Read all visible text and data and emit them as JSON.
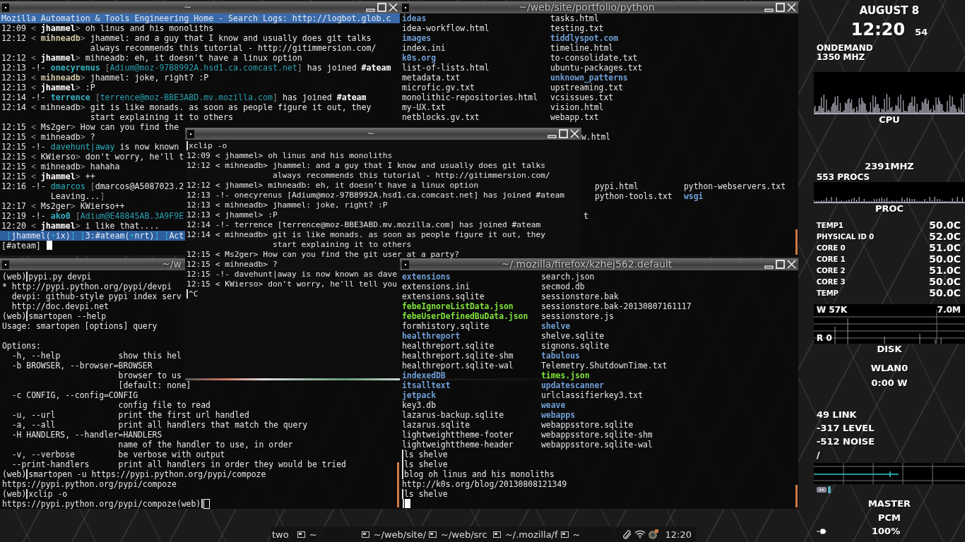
{
  "irc_window": {
    "title": "~",
    "window_buttons": true,
    "topic": "Mozilla Automation & Tools Engineering Home - Search Logs: http://logbot.glob.c",
    "lines": [
      {
        "segments": [
          {
            "kind": "time",
            "text": "12:09"
          },
          {
            "kind": "dim",
            "text": " < "
          },
          {
            "kind": "bold",
            "text": "jhammel"
          },
          {
            "kind": "dim",
            "text": "> "
          },
          {
            "kind": "text",
            "text": "oh linus and his monoliths"
          }
        ]
      },
      {
        "segments": [
          {
            "kind": "time",
            "text": "12:12"
          },
          {
            "kind": "dim",
            "text": " < "
          },
          {
            "kind": "tan",
            "text": "mihneadb"
          },
          {
            "kind": "dim",
            "text": "> "
          },
          {
            "kind": "text",
            "text": "jhammel: and a guy that I know and usually does git talks"
          }
        ]
      },
      {
        "text": "                  always recommends this tutorial - http://gitimmersion.com/"
      },
      {
        "segments": [
          {
            "kind": "time",
            "text": "12:12"
          },
          {
            "kind": "dim",
            "text": " < "
          },
          {
            "kind": "bold",
            "text": "jhammel"
          },
          {
            "kind": "dim",
            "text": "> "
          },
          {
            "kind": "text",
            "text": "mihneadb: eh, it doesn't have a linux option"
          }
        ]
      },
      {
        "segments": [
          {
            "kind": "time",
            "text": "12:13"
          },
          {
            "kind": "text",
            "text": " -!- "
          },
          {
            "kind": "join",
            "text": "onecyrenus"
          },
          {
            "kind": "dim",
            "text": " ["
          },
          {
            "kind": "host",
            "text": "Adium@moz-97B8992A.hsd1.ca.comcast.net"
          },
          {
            "kind": "dim",
            "text": "]"
          },
          {
            "kind": "text",
            "text": " has joined "
          },
          {
            "kind": "bold",
            "text": "#ateam"
          }
        ]
      },
      {
        "segments": [
          {
            "kind": "time",
            "text": "12:13"
          },
          {
            "kind": "dim",
            "text": " < "
          },
          {
            "kind": "tan",
            "text": "mihneadb"
          },
          {
            "kind": "dim",
            "text": "> "
          },
          {
            "kind": "text",
            "text": "jhammel: joke, right? :P"
          }
        ]
      },
      {
        "segments": [
          {
            "kind": "time",
            "text": "12:13"
          },
          {
            "kind": "dim",
            "text": " < "
          },
          {
            "kind": "bold",
            "text": "jhammel"
          },
          {
            "kind": "dim",
            "text": "> "
          },
          {
            "kind": "text",
            "text": ":P"
          }
        ]
      },
      {
        "segments": [
          {
            "kind": "time",
            "text": "12:14"
          },
          {
            "kind": "text",
            "text": " -!- "
          },
          {
            "kind": "join",
            "text": "terrence"
          },
          {
            "kind": "dim",
            "text": " ["
          },
          {
            "kind": "host",
            "text": "terrence@moz-BBE3ABD.mv.mozilla.com"
          },
          {
            "kind": "dim",
            "text": "]"
          },
          {
            "kind": "text",
            "text": " has joined "
          },
          {
            "kind": "bold",
            "text": "#ateam"
          }
        ]
      },
      {
        "segments": [
          {
            "kind": "time",
            "text": "12:14"
          },
          {
            "kind": "dim",
            "text": " < "
          },
          {
            "kind": "text",
            "text": "mihneadb"
          },
          {
            "kind": "dim",
            "text": "> "
          },
          {
            "kind": "text",
            "text": "git is like monads. as soon as people figure it out, they"
          }
        ]
      },
      {
        "text": "                  start explaining it to others"
      },
      {
        "segments": [
          {
            "kind": "time",
            "text": "12:15"
          },
          {
            "kind": "dim",
            "text": " < "
          },
          {
            "kind": "text",
            "text": "Ms2ger"
          },
          {
            "kind": "dim",
            "text": "> "
          },
          {
            "kind": "text",
            "text": "How can you find the"
          }
        ]
      },
      {
        "segments": [
          {
            "kind": "time",
            "text": "12:15"
          },
          {
            "kind": "dim",
            "text": " < "
          },
          {
            "kind": "text",
            "text": "mihneadb"
          },
          {
            "kind": "dim",
            "text": "> "
          },
          {
            "kind": "text",
            "text": "?"
          }
        ]
      },
      {
        "segments": [
          {
            "kind": "time",
            "text": "12:15"
          },
          {
            "kind": "text",
            "text": " -!- "
          },
          {
            "kind": "teal",
            "text": "davehunt|away"
          },
          {
            "kind": "text",
            "text": " is now known"
          }
        ]
      },
      {
        "segments": [
          {
            "kind": "time",
            "text": "12:15"
          },
          {
            "kind": "dim",
            "text": " < "
          },
          {
            "kind": "text",
            "text": "KWierso"
          },
          {
            "kind": "dim",
            "text": "> "
          },
          {
            "kind": "text",
            "text": "don't worry, he'll t"
          }
        ]
      },
      {
        "segments": [
          {
            "kind": "time",
            "text": "12:15"
          },
          {
            "kind": "dim",
            "text": " < "
          },
          {
            "kind": "text",
            "text": "mihneadb"
          },
          {
            "kind": "dim",
            "text": "> "
          },
          {
            "kind": "text",
            "text": "hahaha"
          }
        ]
      },
      {
        "segments": [
          {
            "kind": "time",
            "text": "12:15"
          },
          {
            "kind": "dim",
            "text": " < "
          },
          {
            "kind": "bold",
            "text": "jhammel"
          },
          {
            "kind": "dim",
            "text": "> "
          },
          {
            "kind": "text",
            "text": "++"
          }
        ]
      },
      {
        "segments": [
          {
            "kind": "time",
            "text": "12:16"
          },
          {
            "kind": "text",
            "text": " -!- "
          },
          {
            "kind": "teal",
            "text": "dmarcos"
          },
          {
            "kind": "dim",
            "text": " ["
          },
          {
            "kind": "text",
            "text": "dmarcos@A5087023.2"
          }
        ]
      },
      {
        "segments": [
          {
            "kind": "text",
            "text": "          Leaving..."
          },
          {
            "kind": "dim",
            "text": "]"
          }
        ]
      },
      {
        "segments": [
          {
            "kind": "time",
            "text": "12:17"
          },
          {
            "kind": "dim",
            "text": " < "
          },
          {
            "kind": "text",
            "text": "Ms2ger"
          },
          {
            "kind": "dim",
            "text": "> "
          },
          {
            "kind": "text",
            "text": "KWierso++"
          }
        ]
      },
      {
        "segments": [
          {
            "kind": "time",
            "text": "12:19"
          },
          {
            "kind": "text",
            "text": " -!- "
          },
          {
            "kind": "join",
            "text": "ako0"
          },
          {
            "kind": "dim",
            "text": " ["
          },
          {
            "kind": "host",
            "text": "Adium@E48845AB.3A9F9E"
          }
        ]
      },
      {
        "segments": [
          {
            "kind": "time",
            "text": "12:20"
          },
          {
            "kind": "dim",
            "text": " < "
          },
          {
            "kind": "bold",
            "text": "jhammel"
          },
          {
            "kind": "dim",
            "text": "> "
          },
          {
            "kind": "text",
            "text": "i like that...."
          }
        ]
      }
    ],
    "status": [
      {
        "kind": "bracket",
        "text": " ["
      },
      {
        "kind": "text",
        "text": "jhammel("
      },
      {
        "kind": "teal",
        "text": "+"
      },
      {
        "kind": "text",
        "text": "ix)"
      },
      {
        "kind": "bracket",
        "text": "] ["
      },
      {
        "kind": "text",
        "text": "3:#ateam("
      },
      {
        "kind": "teal",
        "text": "+"
      },
      {
        "kind": "text",
        "text": "nrt)"
      },
      {
        "kind": "bracket",
        "text": "] ["
      },
      {
        "kind": "text",
        "text": "Act"
      }
    ],
    "input": {
      "text": "[#ateam] ",
      "cursor": true,
      "cursor_filled": true
    }
  },
  "portfolio_window": {
    "title": "~/web/site/portfolio/python",
    "window_buttons": true,
    "columns": [
      [
        {
          "name": "ideas",
          "kind": "dir"
        },
        {
          "name": "idea-workflow.html",
          "kind": "file"
        },
        {
          "name": "images",
          "kind": "dir"
        },
        {
          "name": "index.ini",
          "kind": "file"
        },
        {
          "name": "k0s.org",
          "kind": "dir"
        },
        {
          "name": "list-of-lists.html",
          "kind": "file"
        },
        {
          "name": "metadata.txt",
          "kind": "file"
        },
        {
          "name": "microfic.gv.txt",
          "kind": "file"
        },
        {
          "name": "monolithic-repositories.html",
          "kind": "file"
        },
        {
          "name": "my-UX.txt",
          "kind": "file"
        },
        {
          "name": "netblocks.gv.txt",
          "kind": "file"
        }
      ],
      [
        {
          "name": "tasks.html",
          "kind": "file"
        },
        {
          "name": "testing.txt",
          "kind": "file"
        },
        {
          "name": "tiddlyspot.com",
          "kind": "dir"
        },
        {
          "name": "timeline.html",
          "kind": "file"
        },
        {
          "name": "to-consolidate.txt",
          "kind": "file"
        },
        {
          "name": "ubuntu-packages.txt",
          "kind": "file"
        },
        {
          "name": "unknown_patterns",
          "kind": "dir"
        },
        {
          "name": "upstreaming.txt",
          "kind": "file"
        },
        {
          "name": "vcsissues.txt",
          "kind": "file"
        },
        {
          "name": "vision.html",
          "kind": "file"
        },
        {
          "name": "webapp.txt",
          "kind": "file"
        }
      ]
    ],
    "fragments": [
      {
        "text": "w.html"
      },
      {
        "text": "t"
      }
    ],
    "lower_rows": [
      [
        {
          "name": "pypi.html",
          "kind": "file"
        },
        {
          "name": "python-webservers.txt",
          "kind": "file"
        }
      ],
      [
        {
          "name": "python-tools.txt",
          "kind": "file"
        },
        {
          "name": "wsgi",
          "kind": "dir"
        }
      ]
    ]
  },
  "shell_window": {
    "title": "~/w",
    "window_buttons": false,
    "lines": [
      {
        "segments": [
          {
            "kind": "text",
            "text": "(web)"
          },
          {
            "kind": "cmd",
            "text": "pypi.py devpi"
          }
        ]
      },
      {
        "text": "* http://pypi.python.org/pypi/devpi"
      },
      {
        "text": "  devpi: github-style pypi index serv"
      },
      {
        "text": "  http://doc.devpi.net"
      },
      {
        "segments": [
          {
            "kind": "text",
            "text": "(web)"
          },
          {
            "kind": "cmd",
            "text": "smartopen --help"
          }
        ]
      },
      {
        "text": "Usage: smartopen [options] query"
      },
      {
        "text": "Options:",
        "gap_before": true
      },
      {
        "text": "  -h, --help            show this hel"
      },
      {
        "text": "  -b BROWSER, --browser=BROWSER"
      },
      {
        "text": "                        browser to us"
      },
      {
        "text": "                        [default: none]"
      },
      {
        "text": "  -c CONFIG, --config=CONFIG"
      },
      {
        "text": "                        config file to read"
      },
      {
        "text": "  -u, --url             print the first url handled"
      },
      {
        "text": "  -a, --all             print all handlers that match the query"
      },
      {
        "text": "  -H HANDLERS, --handler=HANDLERS"
      },
      {
        "text": "                        name of the handler to use, in order"
      },
      {
        "text": "  -v, --verbose         be verbose with output"
      },
      {
        "text": "  --print-handlers      print all handlers in order they would be tried"
      },
      {
        "segments": [
          {
            "kind": "text",
            "text": "(web)"
          },
          {
            "kind": "cmd",
            "text": "smartopen -u https://pypi.python.org/pypi/compoze"
          }
        ]
      },
      {
        "text": "https://pypi.python.org/pypi/compoze"
      },
      {
        "segments": [
          {
            "kind": "text",
            "text": "(web)"
          },
          {
            "kind": "cmd",
            "text": "xclip -o"
          }
        ]
      },
      {
        "segments": [
          {
            "kind": "text",
            "text": "https://pypi.python.org/pypi/compoze(web)"
          }
        ],
        "bar": true,
        "cursor": true,
        "cursor_filled": false
      }
    ]
  },
  "xclip_window": {
    "title": "~",
    "window_buttons": true,
    "lines": [
      {
        "segments": [
          {
            "kind": "cmd",
            "text": "xclip -o"
          }
        ]
      },
      {
        "text": "12:09 < jhammel> oh linus and his monoliths"
      },
      {
        "text": "12:12 < mihneadb> jhammel: and a guy that I know and usually does git talks"
      },
      {
        "text": "                  always recommends this tutorial - http://gitimmersion.com/"
      },
      {
        "text": "12:12 < jhammel> mihneadb: eh, it doesn't have a linux option"
      },
      {
        "text": "12:13 -!- onecyrenus [Adium@moz-97B8992A.hsd1.ca.comcast.net] has joined #ateam"
      },
      {
        "text": "12:13 < mihneadb> jhammel: joke, right? :P"
      },
      {
        "text": "12:13 < jhammel> :P"
      },
      {
        "text": "12:14 -!- terrence [terrence@moz-BBE3ABD.mv.mozilla.com] has joined #ateam"
      },
      {
        "text": "12:14 < mihneadb> git is like monads. as soon as people figure it out, they"
      },
      {
        "text": "                  start explaining it to others"
      },
      {
        "text": "12:15 < Ms2ger> How can you find the git user at a party?"
      },
      {
        "text": "12:15 < mihneadb> ?"
      },
      {
        "text": "12:15 -!- davehunt|away is now known as dave"
      },
      {
        "text": "12:15 < KWierso> don't worry, he'll tell you"
      },
      {
        "segments": [
          {
            "kind": "cmd",
            "text": "^C"
          }
        ]
      }
    ]
  },
  "mozilla_window": {
    "title": "~/.mozilla/firefox/kzhej562.default",
    "window_buttons": true,
    "columns": [
      [
        {
          "name": "extensions",
          "kind": "dir"
        },
        {
          "name": "extensions.ini",
          "kind": "file"
        },
        {
          "name": "extensions.sqlite",
          "kind": "file"
        },
        {
          "name": "febeIgnoreListData.json",
          "kind": "exec"
        },
        {
          "name": "febeUserDefinedBuData.json",
          "kind": "exec"
        },
        {
          "name": "formhistory.sqlite",
          "kind": "file"
        },
        {
          "name": "healthreport",
          "kind": "dir"
        },
        {
          "name": "healthreport.sqlite",
          "kind": "file"
        },
        {
          "name": "healthreport.sqlite-shm",
          "kind": "file"
        },
        {
          "name": "healthreport.sqlite-wal",
          "kind": "file"
        },
        {
          "name": "indexedDB",
          "kind": "dir"
        },
        {
          "name": "itsalltext",
          "kind": "dir"
        },
        {
          "name": "jetpack",
          "kind": "dir"
        },
        {
          "name": "key3.db",
          "kind": "file"
        },
        {
          "name": "lazarus-backup.sqlite",
          "kind": "file"
        },
        {
          "name": "lazarus.sqlite",
          "kind": "file"
        },
        {
          "name": "lightweighttheme-footer",
          "kind": "file"
        },
        {
          "name": "lightweighttheme-header",
          "kind": "file"
        }
      ],
      [
        {
          "name": "search.json",
          "kind": "file"
        },
        {
          "name": "secmod.db",
          "kind": "file"
        },
        {
          "name": "sessionstore.bak",
          "kind": "file"
        },
        {
          "name": "sessionstore.bak-20130807161117",
          "kind": "file"
        },
        {
          "name": "sessionstore.js",
          "kind": "file"
        },
        {
          "name": "shelve",
          "kind": "dir"
        },
        {
          "name": "shelve.sqlite",
          "kind": "file"
        },
        {
          "name": "signons.sqlite",
          "kind": "file"
        },
        {
          "name": "tabulous",
          "kind": "dir"
        },
        {
          "name": "Telemetry.ShutdownTime.txt",
          "kind": "file"
        },
        {
          "name": "times.json",
          "kind": "exec"
        },
        {
          "name": "updatescanner",
          "kind": "dir"
        },
        {
          "name": "urlclassifierkey3.txt",
          "kind": "file"
        },
        {
          "name": "weave",
          "kind": "dir"
        },
        {
          "name": "webapps",
          "kind": "dir"
        },
        {
          "name": "webappsstore.sqlite",
          "kind": "file"
        },
        {
          "name": "webappsstore.sqlite-shm",
          "kind": "file"
        },
        {
          "name": "webappsstore.sqlite-wal",
          "kind": "file"
        }
      ]
    ],
    "lines": [
      {
        "segments": [
          {
            "kind": "cmd",
            "text": "ls shelve"
          }
        ]
      },
      {
        "segments": [
          {
            "kind": "cmd",
            "text": "ls shelve"
          }
        ]
      },
      {
        "segments": [
          {
            "kind": "cmd",
            "text": "blog oh linus and his monoliths"
          }
        ]
      },
      {
        "text": "http://k0s.org/blog/20130808121349"
      },
      {
        "segments": [
          {
            "kind": "cmd",
            "text": "ls shelve"
          }
        ]
      },
      {
        "bar": true,
        "cursor": true,
        "cursor_filled": true
      }
    ]
  },
  "conky": {
    "date": "AUGUST 8",
    "time": "12:20",
    "seconds": "54",
    "governor": "ONDEMAND",
    "frequency": "1350 MHZ",
    "cpu_label": "CPU",
    "cpu_frequency": "2391MHZ",
    "processes": "553 PROCS",
    "proc_label": "PROC",
    "sensors": [
      {
        "label": "TEMP1",
        "value": "50.0C"
      },
      {
        "label": "PHYSICAL ID 0",
        "value": "52.0C"
      },
      {
        "label": "CORE 0",
        "value": "51.0C"
      },
      {
        "label": "CORE 1",
        "value": "50.0C"
      },
      {
        "label": "CORE 2",
        "value": "51.0C"
      },
      {
        "label": "CORE 3",
        "value": "50.0C"
      },
      {
        "label": "TEMP",
        "value": "50.0C"
      }
    ],
    "disk": {
      "write": "W 57K",
      "peak": "7.0M",
      "read": "R 0",
      "label": "DISK"
    },
    "wlan": {
      "label": "WLAN0",
      "uptime": "0:00 W",
      "link": "49 LINK",
      "signal": "-317 LEVEL",
      "noise": "-512 NOISE",
      "mark": "/"
    },
    "audio": {
      "master": "MASTER",
      "pcm": "PCM",
      "volume": "100%"
    }
  },
  "taskbar": {
    "desktop": "two",
    "tasks": [
      {
        "label": "~"
      },
      {
        "label": "~/web/site/"
      },
      {
        "label": "~/web/src"
      },
      {
        "label": "~/.mozilla/f"
      },
      {
        "label": "~"
      }
    ],
    "clock": "12:20"
  }
}
